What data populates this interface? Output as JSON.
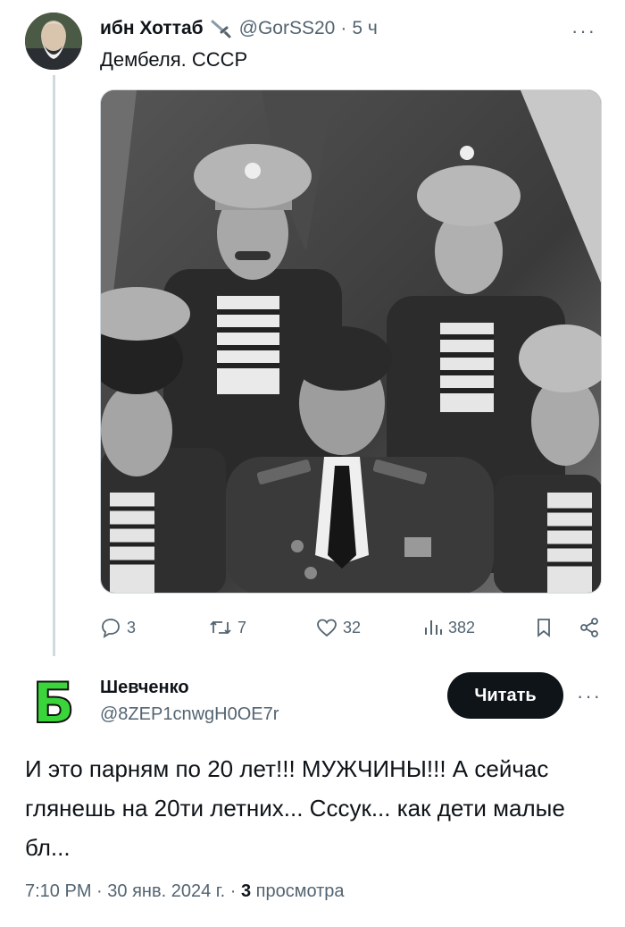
{
  "tweet": {
    "author_name": "ибн Хоттаб",
    "author_handle": "@GorSS20",
    "separator": "·",
    "time_ago": "5 ч",
    "text": "Дембеля. СССР",
    "badge_icon": "sword-emoji-icon",
    "stats": {
      "replies": "3",
      "retweets": "7",
      "likes": "32",
      "views": "382"
    }
  },
  "reply": {
    "author_name": "Шевченко",
    "author_handle": "@8ZEP1cnwgH0OE7r",
    "avatar_letter": "Б",
    "follow_label": "Читать",
    "text": "И  это парням по 20 лет!!!  МУЖЧИНЫ!!!  А сейчас глянешь на 20ти летних...  Сссук...   как дети малые бл...",
    "time": "7:10 PM",
    "date": "30 янв. 2024 г.",
    "separator": "·",
    "views_count": "3",
    "views_label": "просмотра"
  },
  "colors": {
    "text": "#0f1419",
    "secondary": "#536471",
    "divider": "#cfd9de",
    "avatar_letter_green": "#39d53a"
  }
}
